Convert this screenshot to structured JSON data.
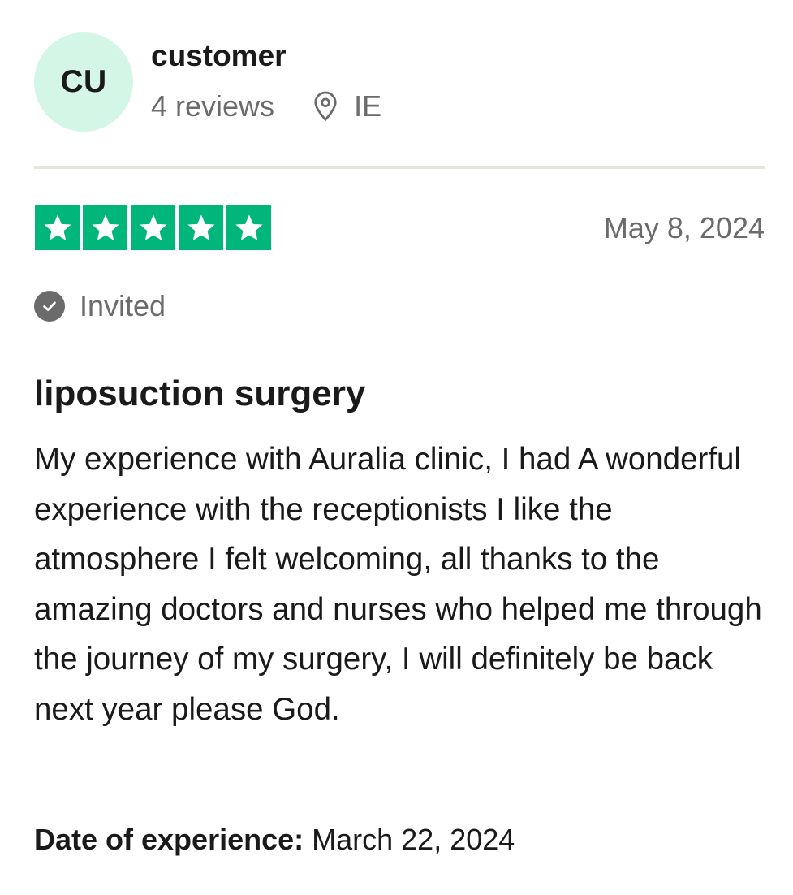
{
  "reviewer": {
    "initials": "CU",
    "name": "customer",
    "reviews_count": "4 reviews",
    "country": "IE"
  },
  "review": {
    "rating": 5,
    "rating_max": 5,
    "date": "May 8, 2024",
    "invited_label": "Invited",
    "title": "liposuction surgery",
    "body": "My experience with Auralia clinic, I had A wonderful experience with the receptionists I like the atmosphere I felt welcoming, all thanks to the amazing doctors and nurses who helped me through the journey of my surgery, I will definitely be back next year please God.",
    "experience_label": "Date of experience:",
    "experience_date": "March 22, 2024"
  },
  "colors": {
    "star_green": "#00b67a",
    "avatar_bg": "#d4f6e6",
    "muted_text": "#6b6b6b",
    "divider": "#e5e5dd"
  },
  "icons": {
    "location": "map-pin-icon",
    "verified": "check-circle-icon",
    "rating": "star-icon"
  }
}
